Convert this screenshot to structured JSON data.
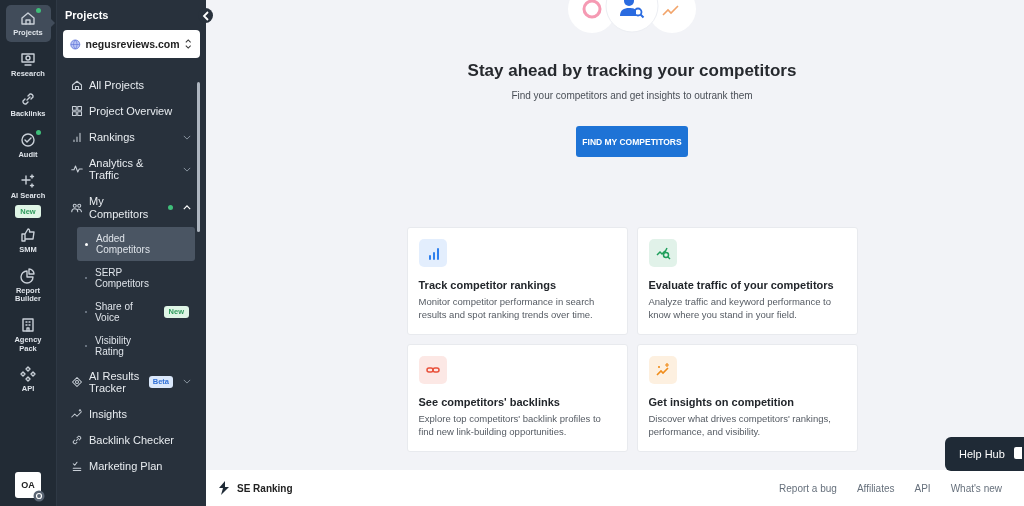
{
  "rail": {
    "items": [
      {
        "label": "Projects",
        "kind": "home",
        "selected": true,
        "dot": true
      },
      {
        "label": "Research",
        "kind": "monitor",
        "selected": false,
        "dot": false
      },
      {
        "label": "Backlinks",
        "kind": "link",
        "selected": false,
        "dot": false
      },
      {
        "label": "Audit",
        "kind": "check",
        "selected": false,
        "dot": true
      },
      {
        "label": "AI Search",
        "kind": "sparkle",
        "selected": false,
        "dot": false,
        "badge": "New"
      },
      {
        "label": "SMM",
        "kind": "thumb",
        "selected": false,
        "dot": false
      },
      {
        "label": "Report Builder",
        "kind": "pie",
        "selected": false,
        "dot": false
      },
      {
        "label": "Agency Pack",
        "kind": "building",
        "selected": false,
        "dot": false
      },
      {
        "label": "API",
        "kind": "api",
        "selected": false,
        "dot": false
      }
    ],
    "avatar": "OA"
  },
  "sidebar": {
    "title": "Projects",
    "project": "negusreviews.com",
    "items": [
      {
        "label": "All Projects",
        "kind": "home",
        "dot": false
      },
      {
        "label": "Project Overview",
        "kind": "grid",
        "dot": false
      },
      {
        "label": "Rankings",
        "kind": "bars",
        "dot": false,
        "expanded": false
      },
      {
        "label": "Analytics & Traffic",
        "kind": "pulse",
        "dot": false,
        "expanded": false
      },
      {
        "label": "My Competitors",
        "kind": "people",
        "dot": true,
        "expanded": true,
        "children": [
          {
            "label": "Added Competitors",
            "selected": true
          },
          {
            "label": "SERP Competitors",
            "selected": false
          },
          {
            "label": "Share of Voice",
            "selected": false,
            "badge": "New"
          },
          {
            "label": "Visibility Rating",
            "selected": false
          }
        ]
      },
      {
        "label": "AI Results Tracker",
        "kind": "ai",
        "dot": false,
        "expanded": false,
        "badge": "Beta"
      },
      {
        "label": "Insights",
        "kind": "trend",
        "dot": false
      },
      {
        "label": "Backlink Checker",
        "kind": "link",
        "dot": false
      },
      {
        "label": "Marketing Plan",
        "kind": "list",
        "dot": false
      }
    ]
  },
  "main": {
    "heading": "Stay ahead by tracking your competitors",
    "subtitle": "Find your competitors and get insights to outrank them",
    "button": "FIND MY COMPETITORS",
    "cards": [
      {
        "title": "Track competitor rankings",
        "text": "Monitor competitor performance in search results and spot ranking trends over time.",
        "kind": "bars",
        "color": "#2f80ed"
      },
      {
        "title": "Evaluate traffic of your competitors",
        "text": "Analyze traffic and keyword performance to know where you stand in your field.",
        "kind": "trend-search",
        "color": "#1e9e5a"
      },
      {
        "title": "See competitors' backlinks",
        "text": "Explore top competitors' backlink profiles to find new link-building opportunities.",
        "kind": "link",
        "color": "#e8503a"
      },
      {
        "title": "Get insights on competition",
        "text": "Discover what drives competitors' rankings, performance, and visibility.",
        "kind": "sparkle-trend",
        "color": "#f08c1a"
      }
    ]
  },
  "footer": {
    "brand": "SE Ranking",
    "links": [
      "Report a bug",
      "Affiliates",
      "API",
      "What's new"
    ]
  },
  "help_hub": "Help Hub"
}
